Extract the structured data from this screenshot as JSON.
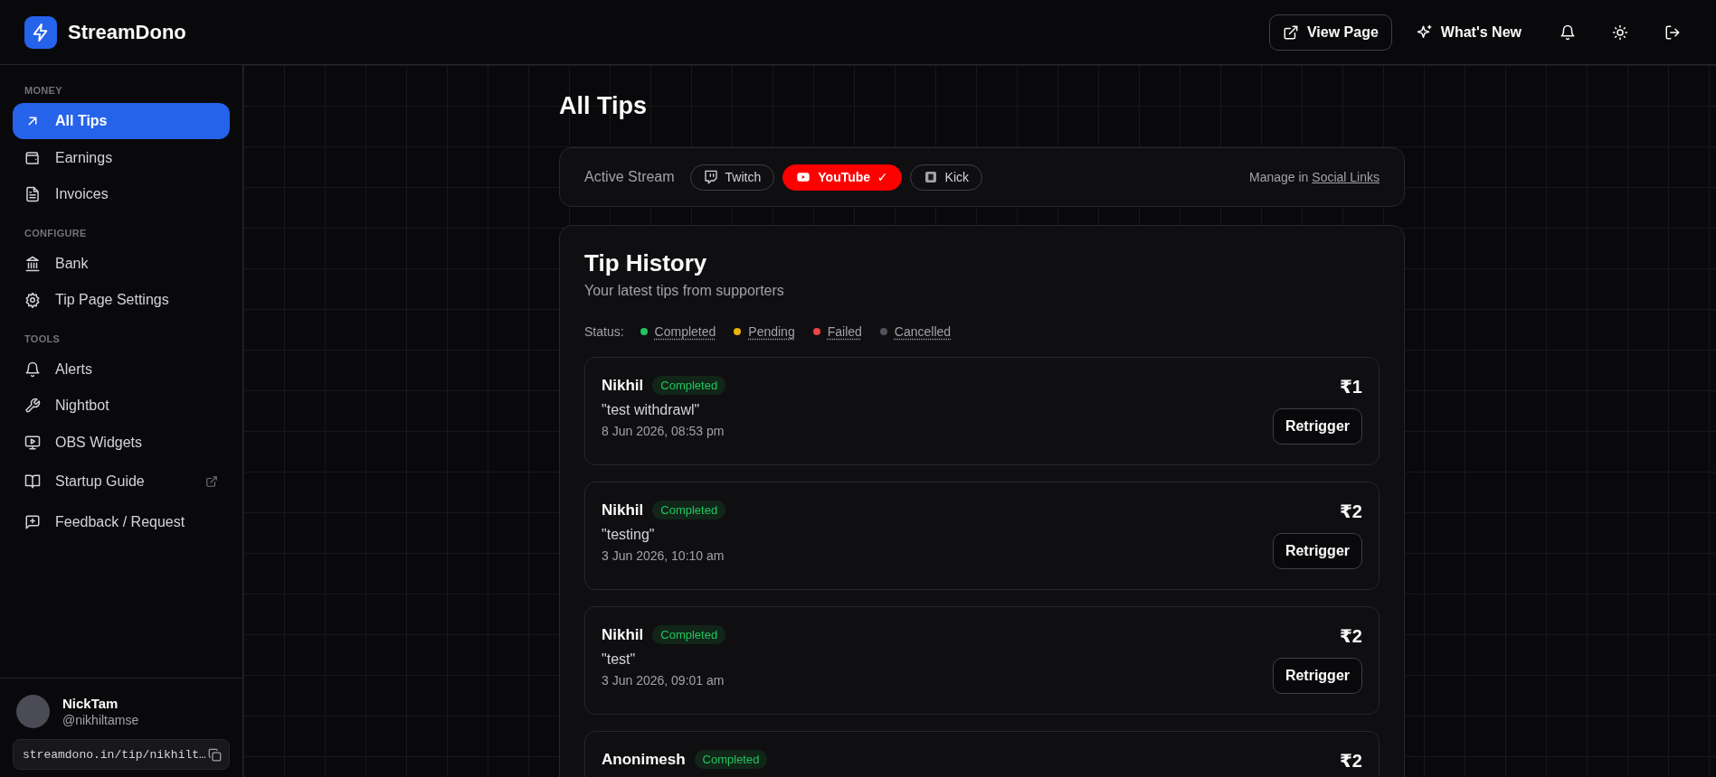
{
  "brand": {
    "name": "StreamDono"
  },
  "header": {
    "actions": [
      {
        "kind": "external",
        "label": "View Page",
        "outlined": true
      },
      {
        "kind": "sparkle",
        "label": "What's New",
        "outlined": false
      }
    ],
    "icons": [
      {
        "kind": "bell"
      },
      {
        "kind": "sun"
      },
      {
        "kind": "logout"
      }
    ]
  },
  "sidebar": {
    "sections": [
      {
        "title": "MONEY",
        "items": [
          {
            "kind": "arrow",
            "label": "All Tips",
            "selected": true,
            "external": false
          },
          {
            "kind": "wallet",
            "label": "Earnings",
            "selected": false,
            "external": false
          },
          {
            "kind": "file",
            "label": "Invoices",
            "selected": false,
            "external": false
          }
        ]
      },
      {
        "title": "CONFIGURE",
        "items": [
          {
            "kind": "bank",
            "label": "Bank",
            "selected": false,
            "external": false
          },
          {
            "kind": "gear",
            "label": "Tip Page Settings",
            "selected": false,
            "external": false
          }
        ]
      },
      {
        "title": "TOOLS",
        "items": [
          {
            "kind": "bell",
            "label": "Alerts",
            "selected": false,
            "external": false
          },
          {
            "kind": "wrench",
            "label": "Nightbot",
            "selected": false,
            "external": false
          },
          {
            "kind": "monitor",
            "label": "OBS Widgets",
            "selected": false,
            "external": false
          },
          {
            "kind": "book",
            "label": "Startup Guide",
            "selected": false,
            "external": true
          },
          {
            "kind": "chat",
            "label": "Feedback / Request",
            "selected": false,
            "external": false
          }
        ]
      }
    ],
    "user": {
      "name": "NickTam",
      "handle": "@nikhiltamse",
      "link": "streamdono.in/tip/nikhilt…"
    }
  },
  "page": {
    "title": "All Tips"
  },
  "active_stream": {
    "label": "Active Stream",
    "selected_mark": "✓",
    "platforms": [
      {
        "kind": "twitch",
        "label": "Twitch",
        "selected": false
      },
      {
        "kind": "youtube",
        "label": "YouTube",
        "selected": true
      },
      {
        "kind": "kick",
        "label": "Kick",
        "selected": false
      }
    ],
    "manage_text": "Manage in",
    "manage_link": "Social Links"
  },
  "tip_history": {
    "title": "Tip History",
    "subtitle": "Your latest tips from supporters",
    "status_label": "Status:",
    "legend": [
      {
        "label": "Completed",
        "color": "#22c55e"
      },
      {
        "label": "Pending",
        "color": "#eab308"
      },
      {
        "label": "Failed",
        "color": "#ef4444"
      },
      {
        "label": "Cancelled",
        "color": "#52525b"
      }
    ],
    "tips": [
      {
        "name": "Nikhil",
        "status": "Completed",
        "color": "#22c55e",
        "message": "\"test withdrawl\"",
        "date": "8 Jun 2026, 08:53 pm",
        "amount": "₹1",
        "action": "Retrigger"
      },
      {
        "name": "Nikhil",
        "status": "Completed",
        "color": "#22c55e",
        "message": "\"testing\"",
        "date": "3 Jun 2026, 10:10 am",
        "amount": "₹2",
        "action": "Retrigger"
      },
      {
        "name": "Nikhil",
        "status": "Completed",
        "color": "#22c55e",
        "message": "\"test\"",
        "date": "3 Jun 2026, 09:01 am",
        "amount": "₹2",
        "action": "Retrigger"
      },
      {
        "name": "Anonimesh",
        "status": "Completed",
        "color": "#22c55e",
        "amount": "₹2"
      }
    ]
  }
}
